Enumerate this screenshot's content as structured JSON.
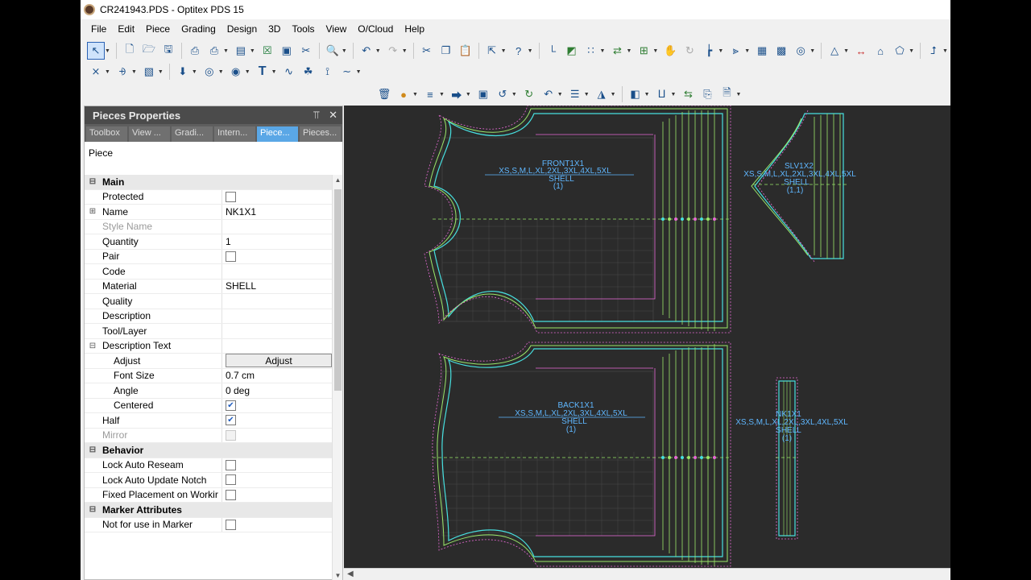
{
  "window": {
    "title": "CR241943.PDS - Optitex PDS 15"
  },
  "menu": [
    "File",
    "Edit",
    "Piece",
    "Grading",
    "Design",
    "3D",
    "Tools",
    "View",
    "O/Cloud",
    "Help"
  ],
  "panel": {
    "title": "Pieces Properties",
    "tabs": [
      "Toolbox",
      "View ...",
      "Gradi...",
      "Intern...",
      "Piece...",
      "Pieces..."
    ],
    "active_tab": "Piece...",
    "heading": "Piece",
    "adjust_button": "Adjust",
    "main_label": "Main",
    "protected": "Protected",
    "name_label": "Name",
    "name_value": "NK1X1",
    "style_name": "Style Name",
    "quantity_label": "Quantity",
    "quantity_value": "1",
    "pair": "Pair",
    "code": "Code",
    "material_label": "Material",
    "material_value": "SHELL",
    "quality": "Quality",
    "description": "Description",
    "tool_layer": "Tool/Layer",
    "description_text": "Description Text",
    "adjust_label": "Adjust",
    "font_size_label": "Font Size",
    "font_size_value": "0.7 cm",
    "angle_label": "Angle",
    "angle_value": "0 deg",
    "centered": "Centered",
    "half": "Half",
    "mirror": "Mirror",
    "behavior_label": "Behavior",
    "lock_auto_reseam": "Lock Auto Reseam",
    "lock_auto_update_notch": "Lock Auto Update Notch",
    "fixed_placement": "Fixed Placement on Workir",
    "marker_attributes_label": "Marker Attributes",
    "not_for_marker": "Not for use in Marker"
  },
  "pieces": [
    {
      "name": "FRONT1X1",
      "sizes": "XS,S,M,L,XL,2XL,3XL,4XL,5XL",
      "material": "SHELL",
      "qty": "(1)"
    },
    {
      "name": "SLV1X2",
      "sizes": "XS,S,M,L,XL,2XL,3XL,4XL,5XL",
      "material": "SHELL",
      "qty": "(1,1)"
    },
    {
      "name": "BACK1X1",
      "sizes": "XS,S,M,L,XL,2XL,3XL,4XL,5XL",
      "material": "SHELL",
      "qty": "(1)"
    },
    {
      "name": "NK1X1",
      "sizes": "XS,S,M,L,XL,2XL,3XL,4XL,5XL",
      "material": "SHELL",
      "qty": "(1)"
    }
  ],
  "colors": {
    "canvas": "#2b2b2b",
    "panel_header": "#4b4b4b",
    "active_tab": "#5aa7e6",
    "grade_cyan": "#47e0e0",
    "grade_green": "#9be86a",
    "grade_pink": "#e86ad6"
  }
}
